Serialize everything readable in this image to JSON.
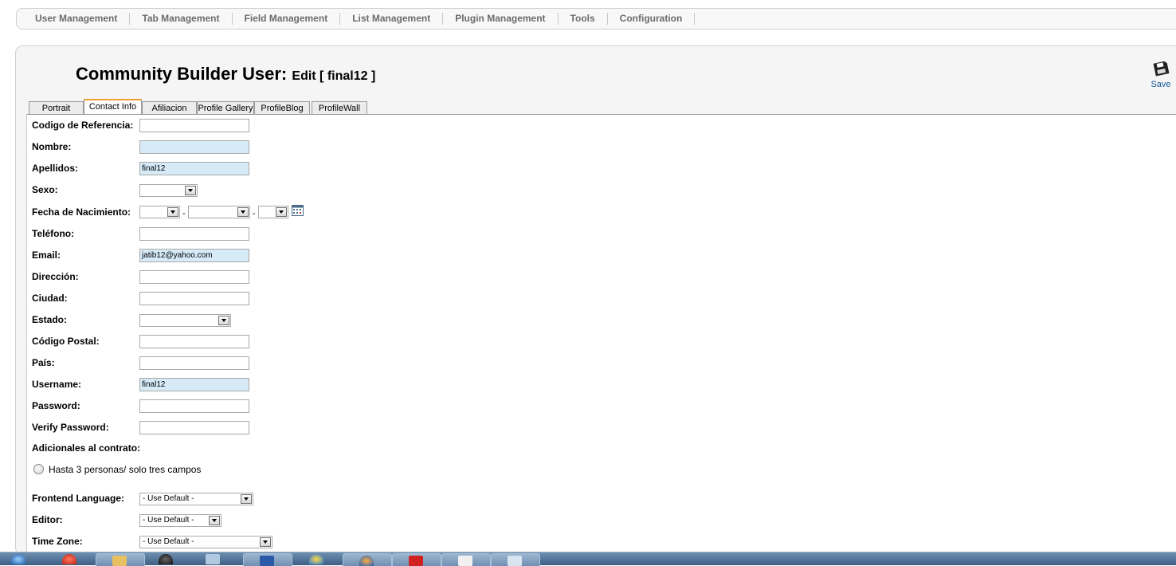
{
  "menu": {
    "items": [
      "User Management",
      "Tab Management",
      "Field Management",
      "List Management",
      "Plugin Management",
      "Tools",
      "Configuration"
    ]
  },
  "header": {
    "title": "Community Builder User:",
    "subtitle": "Edit [ final12 ]",
    "save_label": "Save"
  },
  "tabs": [
    "Portrait",
    "Contact Info",
    "Afiliacion",
    "Profile Gallery",
    "ProfileBlog",
    "ProfileWall"
  ],
  "active_tab": "Contact Info",
  "form": {
    "codigo_label": "Codigo de Referencia:",
    "codigo_value": "",
    "nombre_label": "Nombre:",
    "nombre_value": "",
    "apellidos_label": "Apellidos:",
    "apellidos_value": "final12",
    "sexo_label": "Sexo:",
    "sexo_value": "",
    "fecha_label": "Fecha de Nacimiento:",
    "fecha_sep": "-",
    "telefono_label": "Teléfono:",
    "telefono_value": "",
    "email_label": "Email:",
    "email_value": "jatib12@yahoo.com",
    "direccion_label": "Dirección:",
    "direccion_value": "",
    "ciudad_label": "Ciudad:",
    "ciudad_value": "",
    "estado_label": "Estado:",
    "estado_value": "",
    "postal_label": "Código Postal:",
    "postal_value": "",
    "pais_label": "País:",
    "pais_value": "",
    "username_label": "Username:",
    "username_value": "final12",
    "password_label": "Password:",
    "password_value": "",
    "verify_label": "Verify Password:",
    "verify_value": "",
    "adicionales_label": "Adicionales al contrato:",
    "radio_option": "Hasta 3 personas/ solo tres campos",
    "frontend_label": "Frontend Language:",
    "frontend_value": "- Use Default -",
    "editor_label": "Editor:",
    "editor_value": "- Use Default -",
    "timezone_label": "Time Zone:",
    "timezone_value": "- Use Default -"
  },
  "colors": {
    "required_field_bg": "#d6eaf8",
    "active_tab_accent": "#f0a030",
    "save_text": "#1a5c9e"
  },
  "icons": {
    "save": "floppy-disk-icon",
    "calendar": "calendar-icon"
  }
}
